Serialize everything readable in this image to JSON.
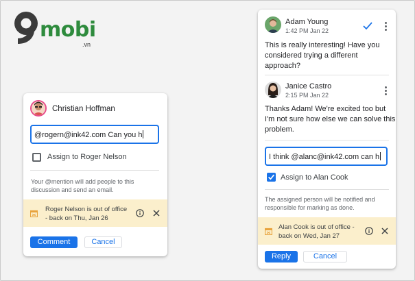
{
  "watermark": {
    "brand": "mobi",
    "tld": ".vn",
    "brand_color": "#2e8b3d"
  },
  "left_card": {
    "author": "Christian Hoffman",
    "input_value": "@rogern@ink42.com Can you h",
    "assign_label": "Assign to Roger Nelson",
    "assign_checked": false,
    "hint": [
      "Your @mention will add people to this",
      "discussion and send an email."
    ],
    "banner": [
      "Roger Nelson is out of office",
      "- back on Thu, Jan 26"
    ],
    "comment_button": "Comment",
    "cancel_button": "Cancel"
  },
  "right_card": {
    "comments": [
      {
        "author": "Adam Young",
        "time": "1:42 PM Jan 22",
        "lines": [
          "This is really interesting! Have you",
          "considered trying a different",
          "approach?"
        ]
      },
      {
        "author": "Janice Castro",
        "time": "2:15 PM Jan 22",
        "lines": [
          "Thanks Adam! We're excited too but",
          "I'm not sure how else we can solve this",
          "problem."
        ]
      }
    ],
    "input_value": "I think @alanc@ink42.com can h",
    "assign_label": "Assign to Alan Cook",
    "assign_checked": true,
    "hint": [
      "The assigned person will be notified and",
      "responsible for marking as done."
    ],
    "banner": [
      "Alan Cook is out of office -",
      "back on Wed, Jan 27"
    ],
    "reply_button": "Reply",
    "cancel_button": "Cancel"
  },
  "colors": {
    "accent": "#1a73e8",
    "banner_bg": "#fbefcc",
    "calendar_icon": "#e8a33d"
  }
}
